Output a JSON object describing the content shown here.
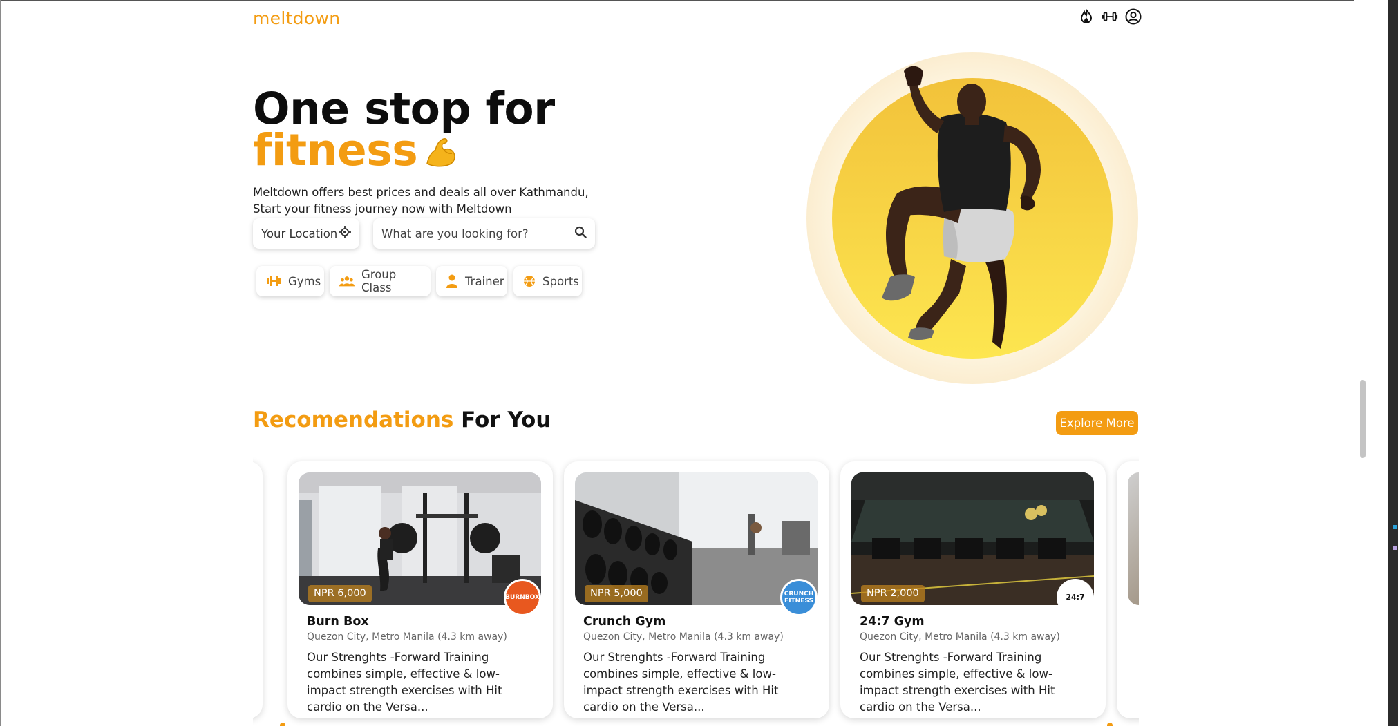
{
  "nav": {
    "logo": "meltdown",
    "icons": [
      "flame-icon",
      "dumbbell-icon",
      "user-circle-icon"
    ]
  },
  "hero": {
    "title_line1": "One stop for",
    "title_line2": "fitness",
    "emoji_icon": "flexed-biceps-icon",
    "desc_line1": "Meltdown offers best prices and deals all over Kathmandu,",
    "desc_line2": "Start your fitness journey now with Meltdown",
    "location_label": "Your Location",
    "search_placeholder": "What are you looking for?",
    "categories": [
      {
        "label": "Gyms",
        "icon": "dumbbell-icon"
      },
      {
        "label": "Group Class",
        "icon": "group-icon"
      },
      {
        "label": "Trainer",
        "icon": "trainer-icon"
      },
      {
        "label": "Sports",
        "icon": "ball-icon"
      }
    ]
  },
  "recommendations": {
    "title_accent": "Recomendations",
    "title_rest": "For You",
    "explore_label": "Explore More",
    "cards": [
      {
        "name": "Burn Box",
        "price": "NPR 6,000",
        "location": "Quezon City, Metro Manila (4.3 km away)",
        "description": "Our Strenghts -Forward Training combines simple, effective & low- impact strength exercises with Hit cardio on the Versa...",
        "logo_text": "BURNBOX"
      },
      {
        "name": "Crunch Gym",
        "price": "NPR 5,000",
        "location": "Quezon City, Metro Manila (4.3 km away)",
        "description": "Our Strenghts -Forward Training combines simple, effective & low- impact strength exercises with Hit cardio on the Versa...",
        "logo_text": "CRUNCH FITNESS"
      },
      {
        "name": "24:7 Gym",
        "price": "NPR 2,000",
        "location": "Quezon City, Metro Manila (4.3 km away)",
        "description": "Our Strenghts -Forward Training combines simple, effective & low- impact strength exercises with Hit cardio on the Versa...",
        "logo_text": "24:7"
      }
    ]
  },
  "colors": {
    "accent": "#f39c12",
    "hero_circle_outer": "#fdf3dc",
    "hero_circle_inner": "#f7cc3e"
  }
}
